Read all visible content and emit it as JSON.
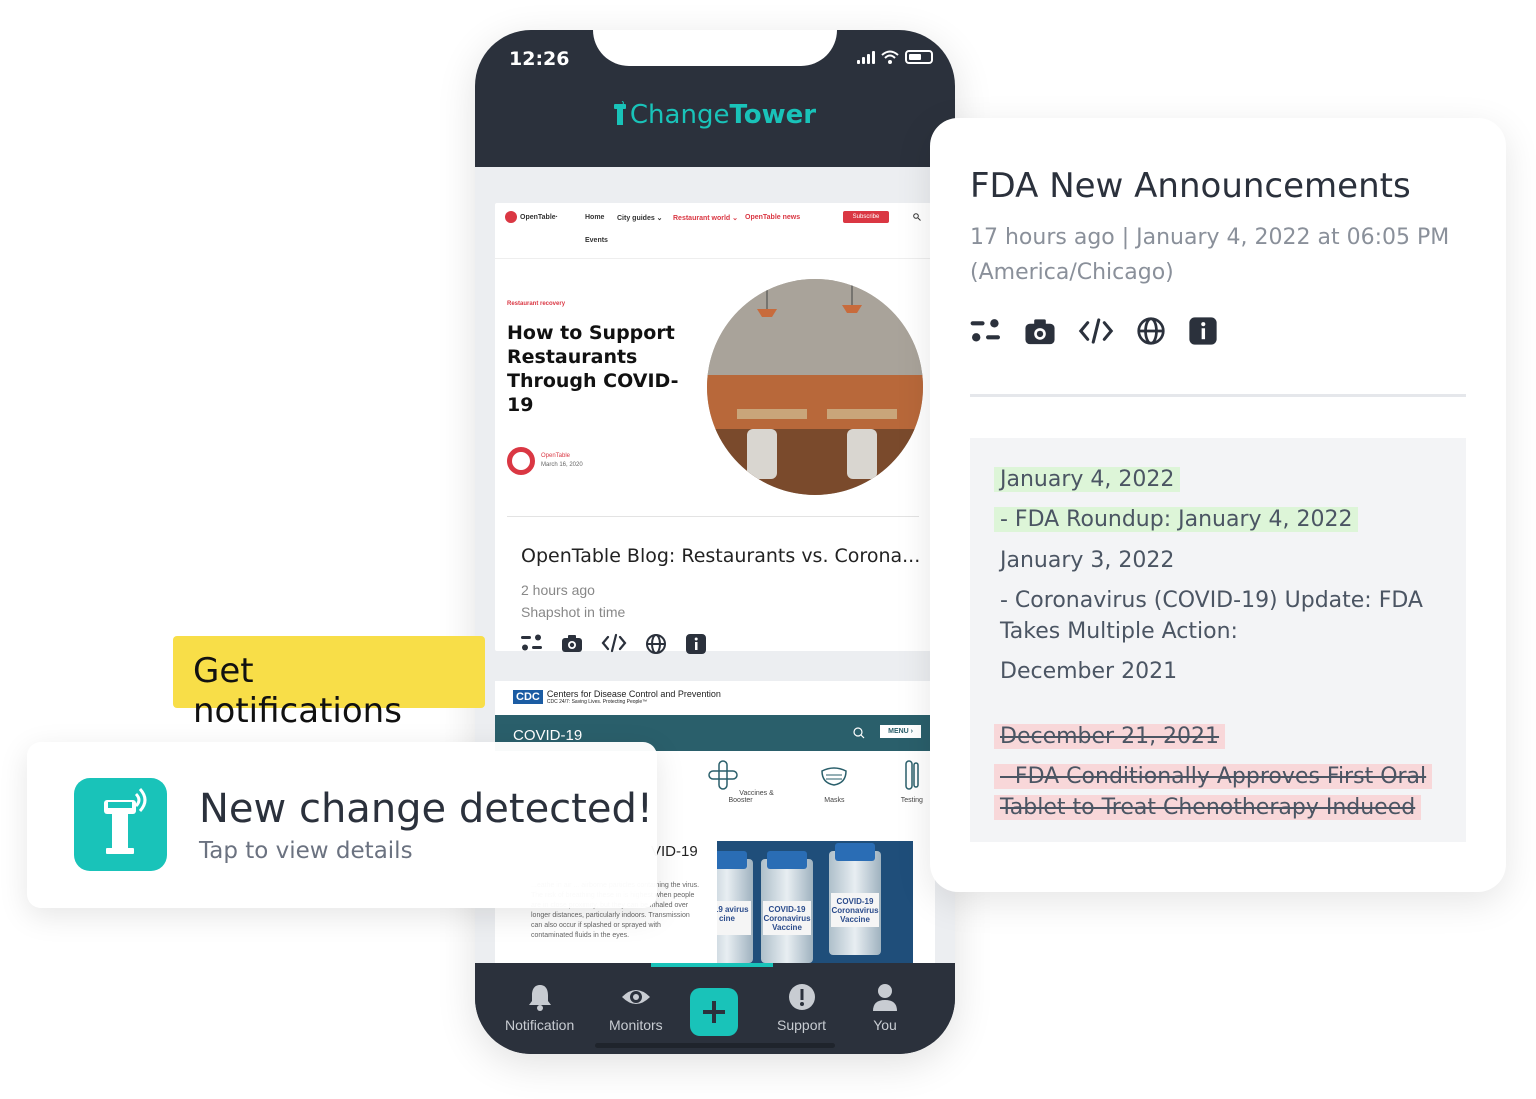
{
  "phone": {
    "status_time": "12:26",
    "brand_light": "Change",
    "brand_bold": "Tower",
    "opentable": {
      "logo": "OpenTable·",
      "nav": [
        "Home",
        "City guides ⌄",
        "Restaurant world ⌄",
        "OpenTable news"
      ],
      "nav_events": "Events",
      "subscribe": "Subscribe",
      "category": "Restaurant recovery",
      "headline": "How to Support Restaurants Through COVID-19",
      "author": "OpenTable",
      "date": "March 16, 2020"
    },
    "monitor_card": {
      "title": "OpenTable Blog: Restaurants vs. Corona...",
      "time": "2 hours ago",
      "subtitle": "Shapshot in time"
    },
    "cdc": {
      "logo": "CDC",
      "org": "Centers for Disease Control and Prevention",
      "tagline": "CDC 24/7: Saving Lives. Protecting People™",
      "bar_title": "COVID-19",
      "menu": "MENU ›",
      "icons": [
        "Vaccines & Booster",
        "Masks",
        "Testing"
      ],
      "heading": "VID-19",
      "body": "...eathe in air ... airborne particles containing the virus. The risk of breathing these in is highest when people are in close proximity, but they can be inhaled over longer distances, particularly indoors. Transmission can also occur if splashed or sprayed with contaminated fluids in the eyes.",
      "vial_labels": [
        "D-19 avirus cine",
        "COVID-19 Coronavirus Vaccine",
        "COVID-19 Coronavirus Vaccine"
      ]
    },
    "tabs": [
      "Notification",
      "Monitors",
      "Support",
      "You"
    ]
  },
  "tag": "Get notifications",
  "notification": {
    "title": "New change detected!",
    "subtitle": "Tap to view details"
  },
  "detail": {
    "title": "FDA New Announcements",
    "meta": "17 hours ago | January 4, 2022 at 06:05 PM (America/Chicago)",
    "diff": [
      {
        "text": "January 4, 2022",
        "type": "added"
      },
      {
        "text": "- FDA Roundup: January 4, 2022",
        "type": "added"
      },
      {
        "text": "January 3, 2022",
        "type": "unchanged"
      },
      {
        "text": "- Coronavirus (COVID-19) Update: FDA Takes Multiple Action:",
        "type": "unchanged"
      },
      {
        "text": "December 2021",
        "type": "unchanged"
      },
      {
        "text": "December 21, 2021",
        "type": "removed"
      },
      {
        "text": "- FDA Conditionally Approves First Oral",
        "type": "removed"
      },
      {
        "text": "Tablet to Treat Chenotherapy Indueed",
        "type": "removed"
      }
    ]
  },
  "colors": {
    "brand": "#19c3b9",
    "dark": "#2b313c",
    "tag": "#f8de48",
    "added": "#ddf5d8",
    "removed": "#f8d7d9"
  },
  "icons": [
    "compare-icon",
    "camera-icon",
    "code-icon",
    "globe-icon",
    "info-icon",
    "bell-icon",
    "eye-icon",
    "plus-icon",
    "alert-icon",
    "user-icon",
    "tower-icon"
  ]
}
